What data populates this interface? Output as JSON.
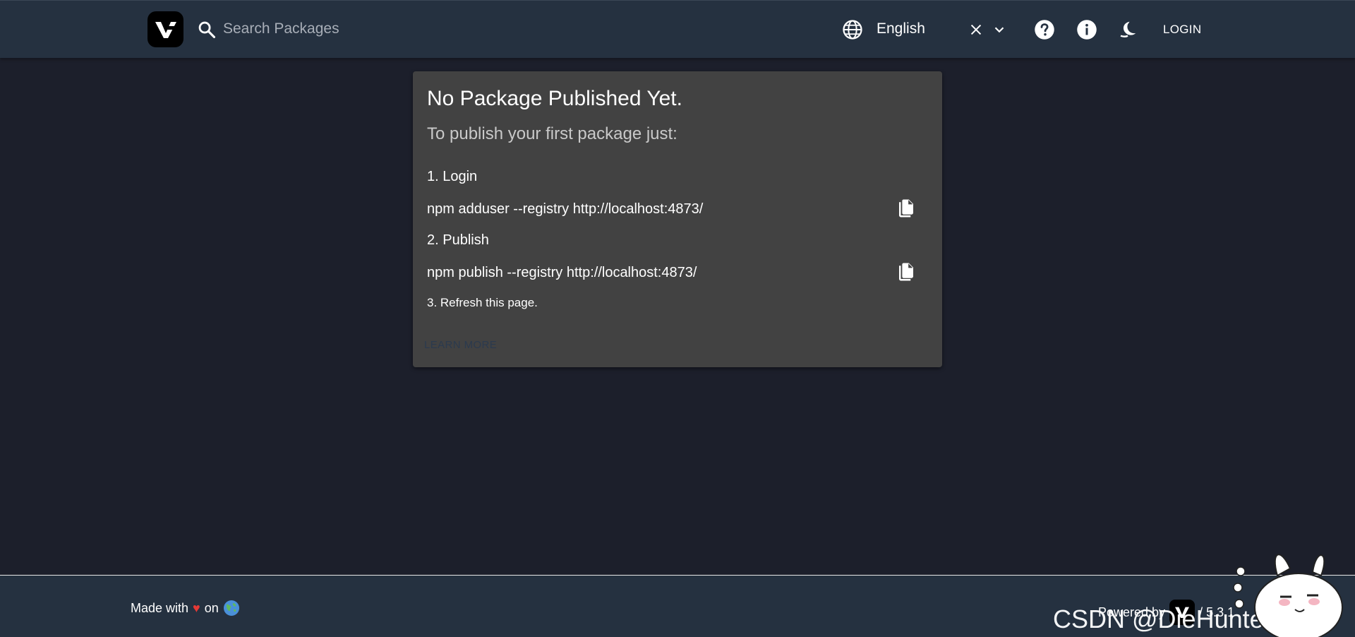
{
  "header": {
    "search_placeholder": "Search Packages",
    "language": "English",
    "login_label": "LOGIN"
  },
  "card": {
    "title": "No Package Published Yet.",
    "subtitle": "To publish your first package just:",
    "steps": [
      {
        "label": "1. Login",
        "command": "npm adduser --registry http://localhost:4873/"
      },
      {
        "label": "2. Publish",
        "command": "npm publish --registry http://localhost:4873/"
      },
      {
        "label": "3. Refresh this page."
      }
    ],
    "learn_more": "LEARN MORE"
  },
  "footer": {
    "made_with_prefix": "Made with",
    "made_with_suffix": "on",
    "powered_by": "Powered by",
    "version": "/ 5.3.1"
  },
  "watermark": {
    "text": "CSDN @DieHunter1024"
  },
  "icons": {
    "logo": "verdaccio-logo",
    "search": "search-icon",
    "language": "globe-icon",
    "clear": "close-icon",
    "dropdown": "chevron-down-icon",
    "help": "help-icon",
    "info": "info-icon",
    "theme": "moon-icon",
    "copy": "copy-icon",
    "earth": "earth-icon"
  },
  "colors": {
    "background": "#1c1f2b",
    "header": "#253140",
    "card": "#424242",
    "heart": "#e53935"
  }
}
